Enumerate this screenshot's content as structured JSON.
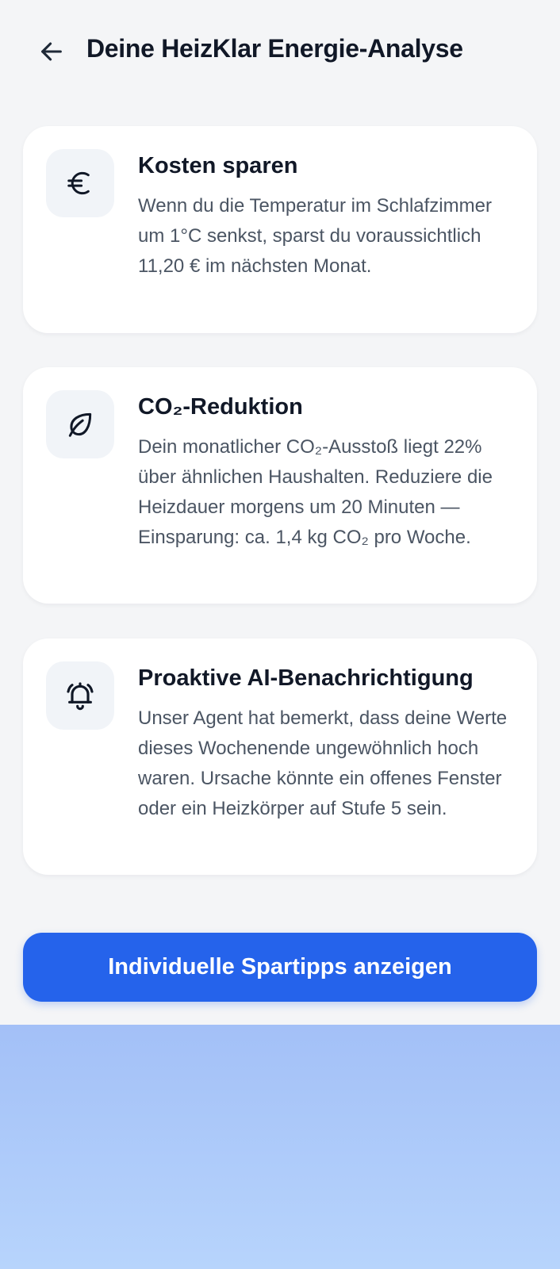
{
  "header": {
    "back_icon": "arrow-left-icon",
    "title": "Deine HeizKlar Energie-Analyse"
  },
  "cards": [
    {
      "icon": "euro-icon",
      "title": "Kosten sparen",
      "body": "Wenn du die Temperatur im Schlafzimmer um 1°C senkst, sparst du voraussichtlich 11,20 € im nächsten Monat."
    },
    {
      "icon": "leaf-icon",
      "title": "CO₂-Reduktion",
      "body": "Dein monatlicher CO₂-Ausstoß liegt 22% über ähnlichen Haushalten. Reduziere die Heizdauer morgens um 20 Minuten — Einsparung: ca. 1,4 kg CO₂ pro Woche."
    },
    {
      "icon": "bell-ringing-icon",
      "title": "Proaktive AI-Benachrichtigung",
      "body": "Unser Agent hat bemerkt, dass deine Werte dieses Wochenende ungewöhnlich hoch waren. Ursache könnte ein offenes Fenster oder ein Heizkörper auf Stufe 5 sein."
    }
  ],
  "cta": {
    "label": "Individuelle Spartipps anzeigen"
  },
  "colors": {
    "background": "#f4f5f7",
    "primary": "#2563eb",
    "title": "#111827",
    "body": "#4b5563",
    "icon_bg": "#f1f4f8"
  }
}
